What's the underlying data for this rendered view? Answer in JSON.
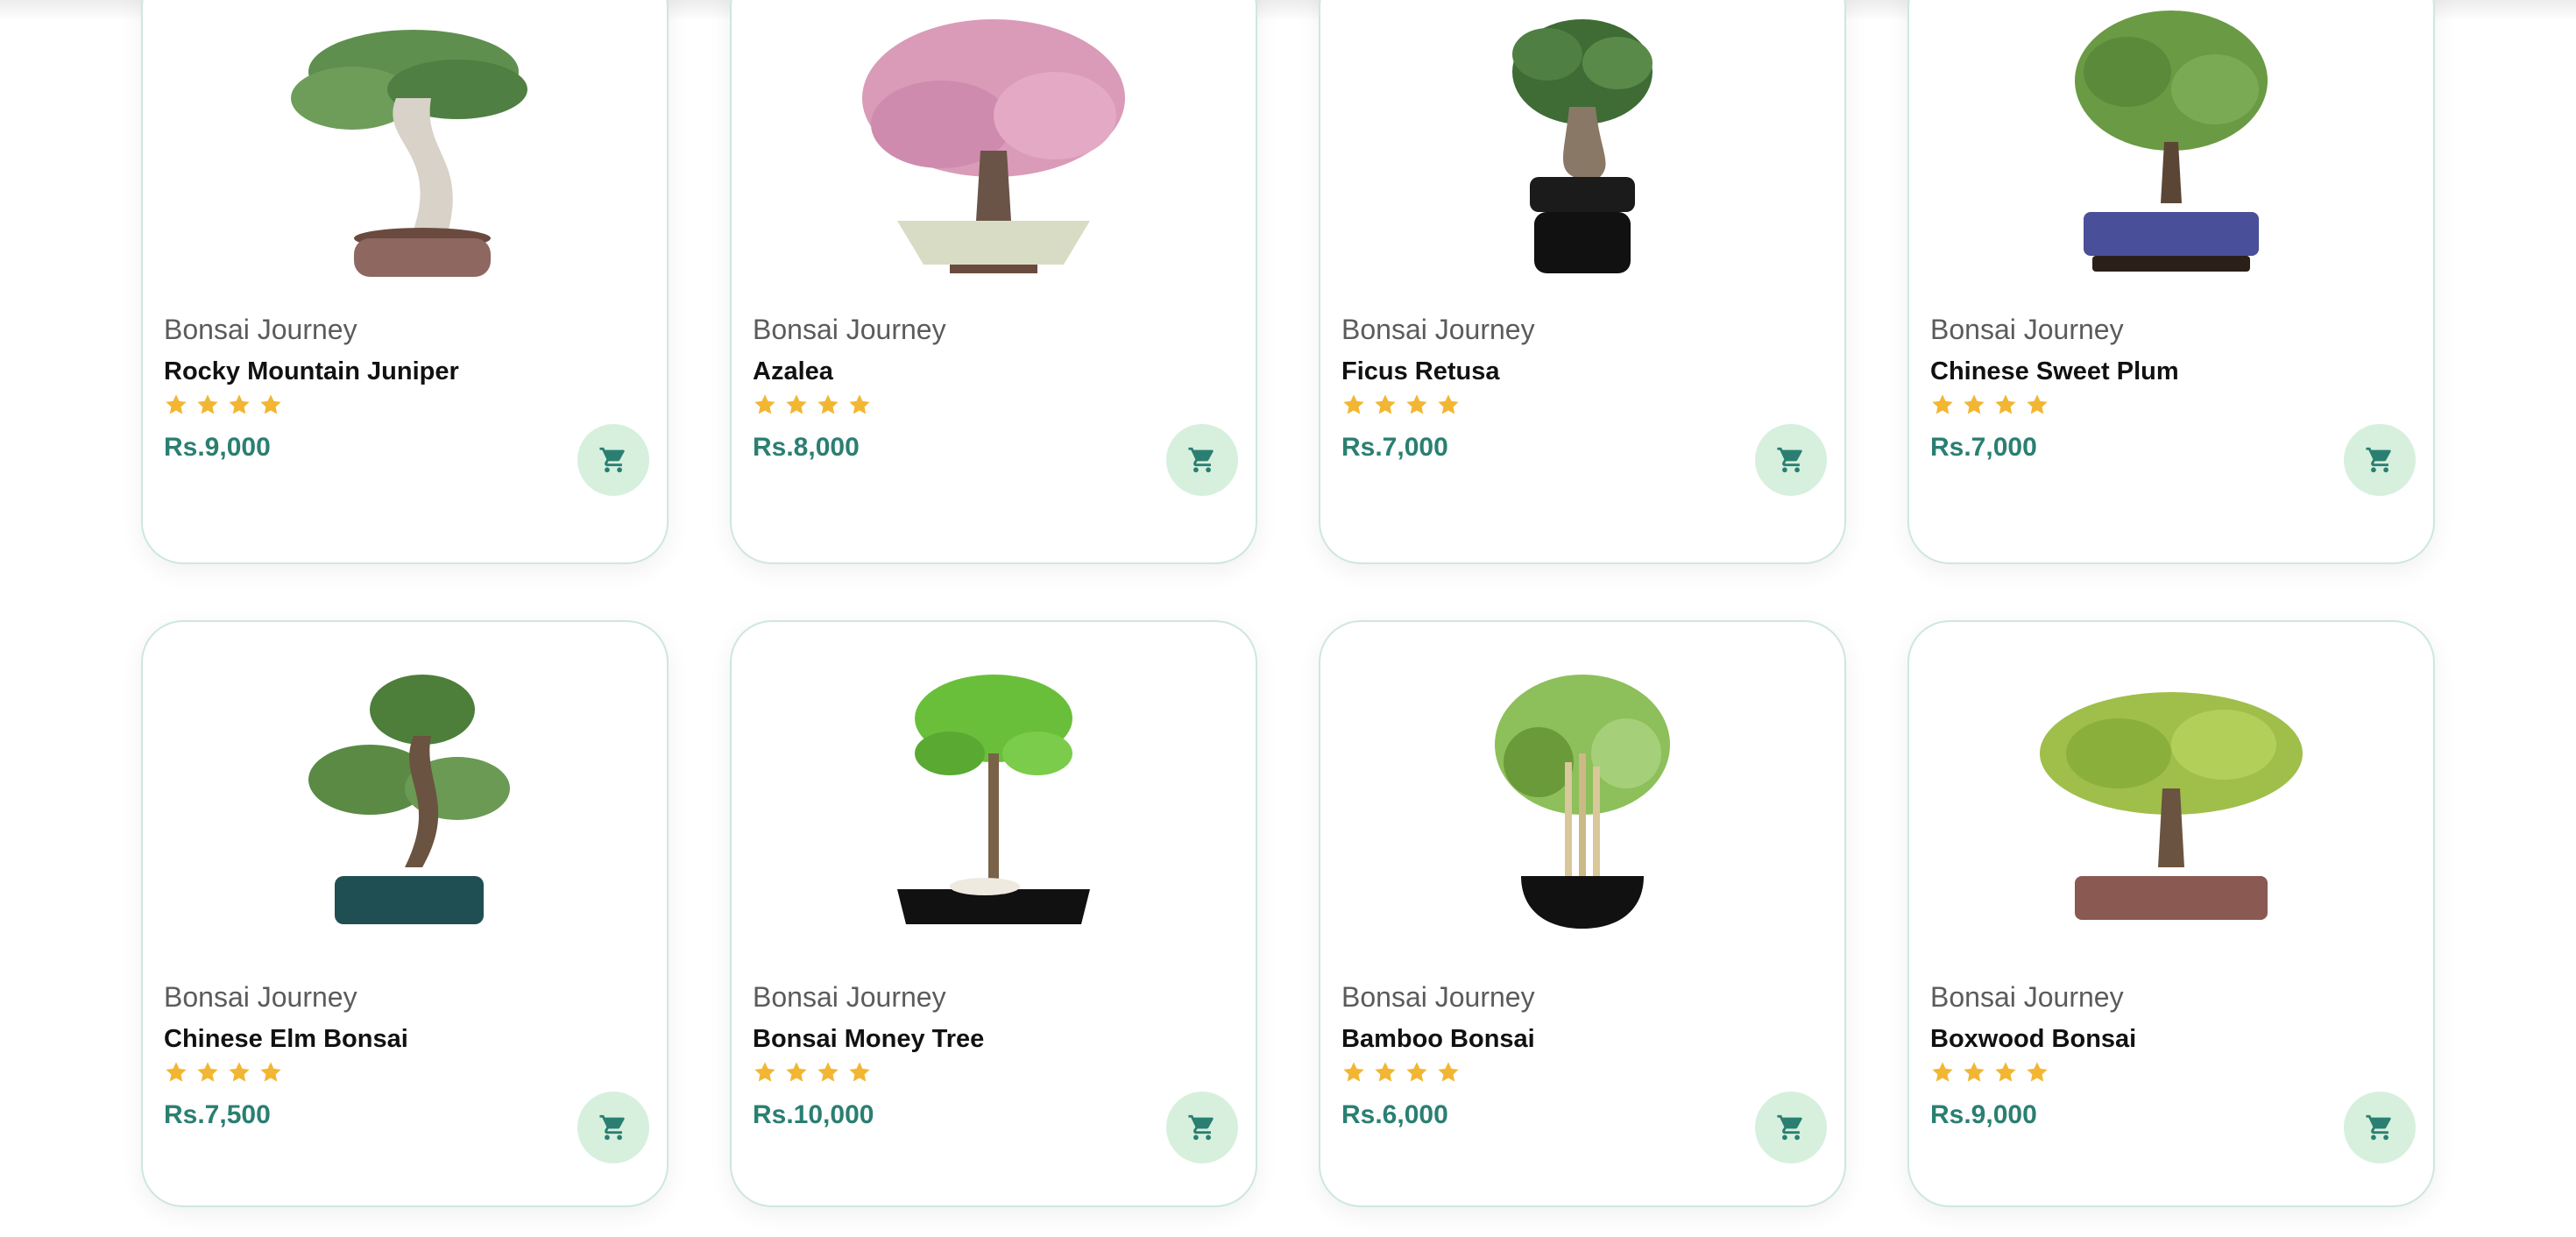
{
  "products": [
    {
      "brand": "Bonsai Journey",
      "name": "Rocky Mountain Juniper",
      "price": "Rs.9,000",
      "rating": 4,
      "icon": "juniper-bonsai"
    },
    {
      "brand": "Bonsai Journey",
      "name": "Azalea",
      "price": "Rs.8,000",
      "rating": 4,
      "icon": "azalea-bonsai"
    },
    {
      "brand": "Bonsai Journey",
      "name": "Ficus Retusa",
      "price": "Rs.7,000",
      "rating": 4,
      "icon": "ficus-bonsai"
    },
    {
      "brand": "Bonsai Journey",
      "name": "Chinese Sweet Plum",
      "price": "Rs.7,000",
      "rating": 4,
      "icon": "sweet-plum-bonsai"
    },
    {
      "brand": "Bonsai Journey",
      "name": "Chinese Elm Bonsai",
      "price": "Rs.7,500",
      "rating": 4,
      "icon": "elm-bonsai"
    },
    {
      "brand": "Bonsai Journey",
      "name": "Bonsai Money Tree",
      "price": "Rs.10,000",
      "rating": 4,
      "icon": "money-tree-bonsai"
    },
    {
      "brand": "Bonsai Journey",
      "name": "Bamboo Bonsai",
      "price": "Rs.6,000",
      "rating": 4,
      "icon": "bamboo-bonsai"
    },
    {
      "brand": "Bonsai Journey",
      "name": "Boxwood Bonsai",
      "price": "Rs.9,000",
      "rating": 4,
      "icon": "boxwood-bonsai"
    }
  ],
  "colors": {
    "price": "#2a7f72",
    "star": "#f2b632",
    "cart_bg": "#d6f0dd",
    "cart_icon": "#2a7f72",
    "card_border": "#cfe6e1"
  }
}
